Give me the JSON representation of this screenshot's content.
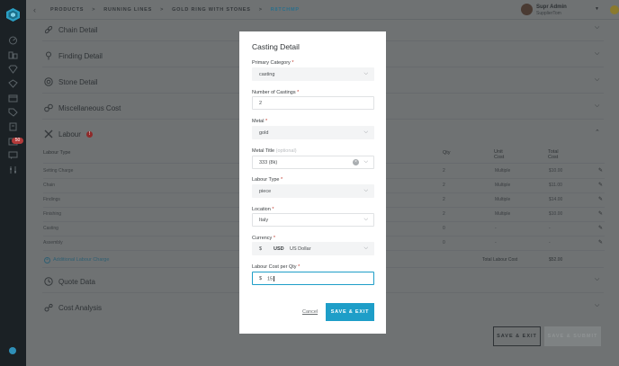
{
  "breadcrumb": {
    "items": [
      "PRODUCTS",
      "RUNNING LINES",
      "GOLD RING WITH STONES"
    ],
    "current": "R8TCHMP",
    "separator": ">"
  },
  "user": {
    "name": "Supr Admin",
    "role": "SupplierTom"
  },
  "sidebar": {
    "badge": "50"
  },
  "sections": {
    "chain": "Chain Detail",
    "finding": "Finding Detail",
    "stone": "Stone Detail",
    "misc": "Miscellaneous Cost",
    "labour": "Labour",
    "quote": "Quote Data",
    "cost": "Cost Analysis"
  },
  "labour_table": {
    "headers": {
      "type": "Labour Type",
      "qty": "Qty",
      "unit": "Unit Cost",
      "total": "Total Cost"
    },
    "rows": [
      {
        "type": "Setting Charge",
        "qty": "2",
        "unit": "Multiple",
        "total": "$10.00"
      },
      {
        "type": "Chain",
        "qty": "2",
        "unit": "Multiple",
        "total": "$11.00"
      },
      {
        "type": "Findings",
        "qty": "2",
        "unit": "Multiple",
        "total": "$14.00"
      },
      {
        "type": "Finishing",
        "qty": "2",
        "unit": "Multiple",
        "total": "$10.00"
      },
      {
        "type": "Casting",
        "qty": "0",
        "unit": "-",
        "total": "-"
      },
      {
        "type": "Assembly",
        "qty": "0",
        "unit": "-",
        "total": "-"
      }
    ],
    "total_label": "Total Labour Cost",
    "total_value": "$52.00",
    "add_link": "Additional Labour Charge"
  },
  "page_buttons": {
    "save_exit": "SAVE & EXIT",
    "save_submit": "SAVE & SUBMIT"
  },
  "modal": {
    "title": "Casting Detail",
    "required_mark": "*",
    "primary_category": {
      "label": "Primary Category",
      "value": "casting"
    },
    "number_of_castings": {
      "label": "Number of Castings",
      "value": "2"
    },
    "metal": {
      "label": "Metal",
      "value": "gold"
    },
    "metal_title": {
      "label": "Metal Title",
      "optional": "(optional)",
      "value": "333 (8k)"
    },
    "labour_type": {
      "label": "Labour Type",
      "value": "piece"
    },
    "location": {
      "label": "Location",
      "value": "Italy"
    },
    "currency": {
      "label": "Currency",
      "symbol": "$",
      "code": "USD",
      "name": "US Dollar"
    },
    "labour_cost": {
      "label": "Labour Cost per Qty",
      "symbol": "$",
      "value": "15"
    },
    "cancel": "Cancel",
    "save": "SAVE & EXIT"
  },
  "icons": {
    "dropdown": "chevron-down",
    "clear": "×"
  }
}
